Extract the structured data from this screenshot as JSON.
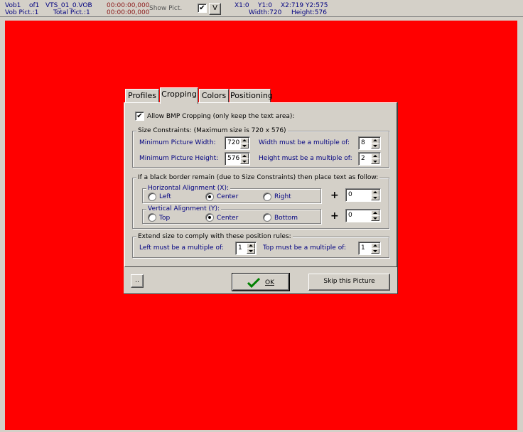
{
  "statusbar": {
    "vob_label": "Vob1",
    "of_label": "of1",
    "filename": "VTS_01_0.VOB",
    "time_start": "00:00:00,000",
    "time_end": "00:00:00,000",
    "vob_pict": "Vob Pict.:1",
    "total_pict": "Total Pict.:1",
    "show_pict_label": "Show Pict.",
    "show_pict_checked": "✔",
    "v_button": "V",
    "x1": "X1:0",
    "y1": "Y1:0",
    "x2": "X2:719",
    "y2": "Y2:575",
    "width": "Width:720",
    "height": "Height:576"
  },
  "tabs": [
    "Profiles",
    "Cropping",
    "Colors",
    "Positioning"
  ],
  "cropping": {
    "allow_bmp_label": "Allow BMP Cropping (only keep the text area):",
    "allow_bmp_checked": "✔",
    "size_group_title": "Size Constraints: (Maximum size is 720 x 576)",
    "min_width_label": "Minimum Picture Width:",
    "min_width_value": "720",
    "min_height_label": "Minimum Picture Height:",
    "min_height_value": "576",
    "width_multiple_label": "Width must be a multiple of:",
    "width_multiple_value": "8",
    "height_multiple_label": "Height must be a multiple of:",
    "height_multiple_value": "2",
    "border_group_title": "If a black border remain (due to Size Constraints) then place text as follow:",
    "horizontal_title": "Horizontal Alignment (X):",
    "horizontal_options": [
      "Left",
      "Center",
      "Right"
    ],
    "horizontal_selected": "Center",
    "horizontal_offset": "0",
    "vertical_title": "Vertical Alignment (Y):",
    "vertical_options": [
      "Top",
      "Center",
      "Bottom"
    ],
    "vertical_selected": "Center",
    "vertical_offset": "0",
    "plus_sign": "+",
    "extend_group_title": "Extend size to comply with these position rules:",
    "left_multiple_label": "Left must be a multiple of:",
    "left_multiple_value": "1",
    "top_multiple_label": "Top must be a multiple of:",
    "top_multiple_value": "1"
  },
  "buttons": {
    "more": "..",
    "ok": "OK",
    "skip": "Skip this Picture"
  },
  "colors": {
    "canvas": "#ff0000",
    "face": "#d4d0c8",
    "label_blue": "#000080",
    "ok_check": "#008000"
  }
}
